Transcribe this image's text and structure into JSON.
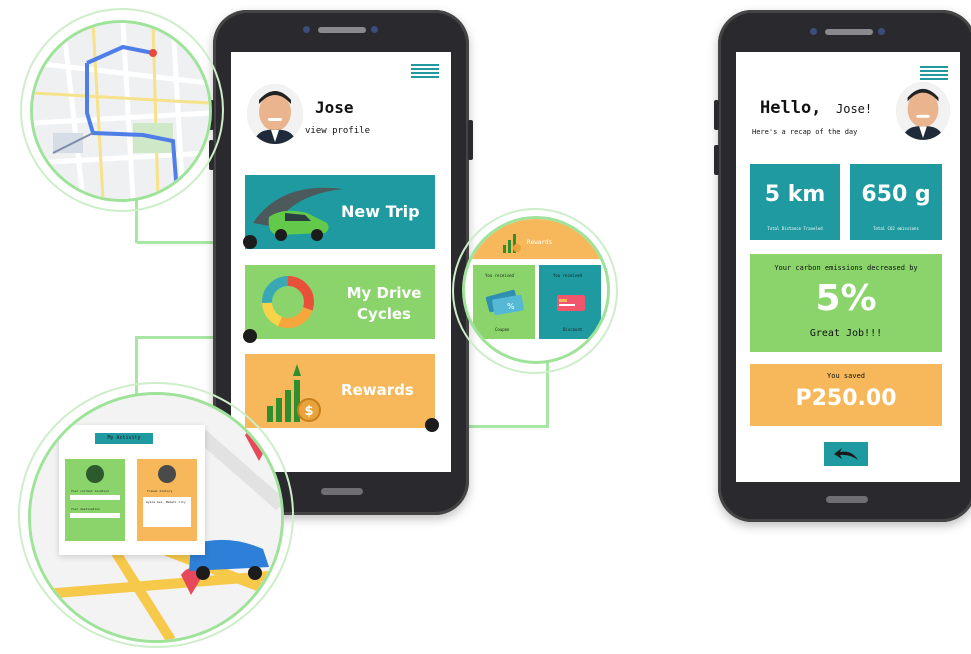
{
  "left_phone": {
    "profile_name": "Jose",
    "view_profile": "view profile",
    "cards": [
      {
        "label": "New Trip",
        "color": "#1e9aa0"
      },
      {
        "label_line1": "My Drive",
        "label_line2": "Cycles",
        "color": "#8ad46b"
      },
      {
        "label": "Rewards",
        "color": "#f6b85a"
      }
    ]
  },
  "bubble_rewards": {
    "title": "Rewards",
    "left_tile": {
      "top": "You received",
      "bottom": "Coupon"
    },
    "right_tile": {
      "top": "You received",
      "bottom": "Discount"
    }
  },
  "bubble_activity": {
    "title": "My Activity",
    "left_card": {
      "line1": "Your current location",
      "line2": "Your destination"
    },
    "right_card": {
      "line1": "Travel history",
      "line2": "Ayala Ave, Makati City"
    }
  },
  "right_phone": {
    "greeting": "Hello,",
    "name": "Jose!",
    "subtitle": "Here's a recap of the day",
    "stat1": {
      "value": "5 km",
      "label": "Total Distance Traveled"
    },
    "stat2": {
      "value": "650 g",
      "label": "Total CO2 emissions"
    },
    "emission": {
      "line1": "Your carbon emissions decreased by",
      "value": "5%",
      "line2": "Great Job!!!"
    },
    "saved": {
      "label": "You saved",
      "value": "P250.00"
    }
  },
  "colors": {
    "teal": "#1e9aa0",
    "green": "#8ad46b",
    "orange": "#f6b85a",
    "connector": "#a8e6a3"
  }
}
